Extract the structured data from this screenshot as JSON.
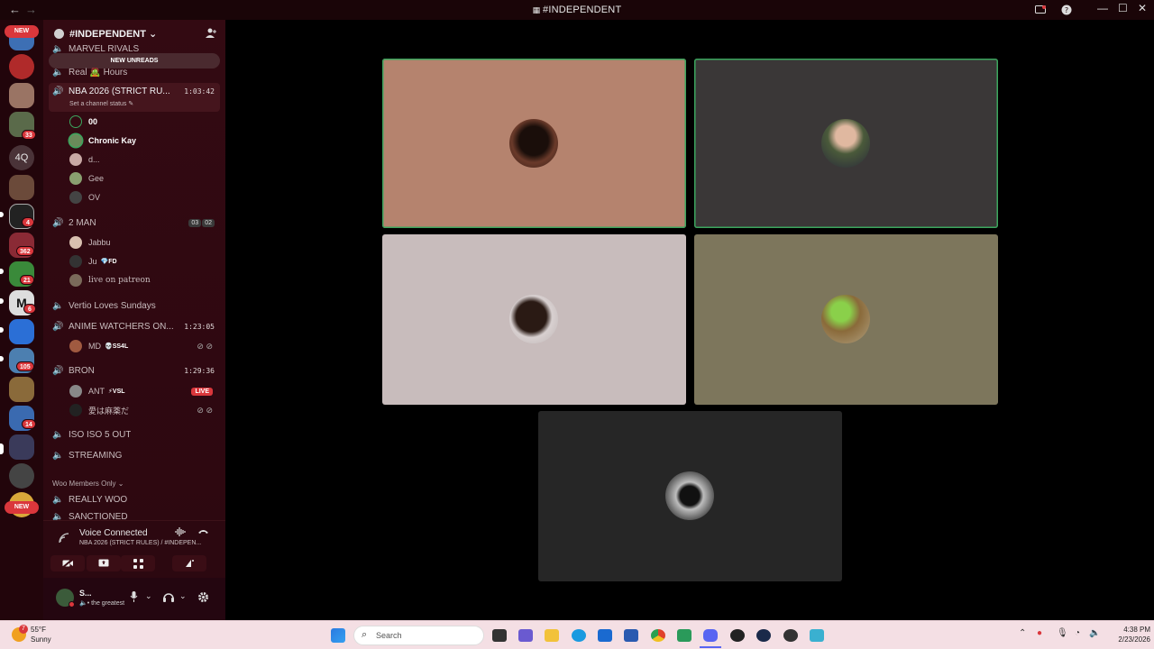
{
  "window": {
    "title": "#INDEPENDENT",
    "back": "←",
    "forward": "→"
  },
  "rail": {
    "new_top": "NEW",
    "new_bottom": "NEW",
    "text_server": "4Q",
    "badges": [
      "33",
      "4",
      "362",
      "21",
      "6",
      "105",
      "14"
    ]
  },
  "server": {
    "name": "#INDEPENDENT",
    "chevron": "⌄",
    "new_unreads": "NEW UNREADS"
  },
  "channels": {
    "marvel": "MARVEL RIVALS",
    "real_hours": "Real 🧟 Hours",
    "nba": {
      "name": "NBA 2026 (STRICT RU...",
      "time": "1:03:42",
      "status_hint": "Set a channel status ✎"
    },
    "nba_users": [
      {
        "name": "00"
      },
      {
        "name": "Chronic Kay"
      },
      {
        "name": "d..."
      },
      {
        "name": "Gee"
      },
      {
        "name": "OV"
      }
    ],
    "two_man": {
      "name": "2 MAN",
      "count_a": "03",
      "count_b": "02"
    },
    "two_man_users": [
      {
        "name": "Jabbu"
      },
      {
        "name": "Ju",
        "tag": "💎FD"
      },
      {
        "name": "live on patreon"
      }
    ],
    "vertio": "Vertio Loves Sundays",
    "anime": {
      "name": "ANIME WATCHERS ON...",
      "time": "1:23:05"
    },
    "anime_users": [
      {
        "name": "MD",
        "tag": "💀SS4L"
      }
    ],
    "bron": {
      "name": "BRON",
      "time": "1:29:36"
    },
    "bron_users": [
      {
        "name": "ANT",
        "tag": "⚡VSL",
        "live": "LIVE"
      },
      {
        "name": "愛は麻薬だ"
      }
    ],
    "iso": "ISO ISO 5 OUT",
    "streaming": "STREAMING",
    "category": "Woo Members Only ⌄",
    "really_woo": "REALLY WOO",
    "sanctioned": "SANCTIONED"
  },
  "voice": {
    "title": "Voice Connected",
    "subtitle": "NBA 2026 (STRICT RULES) / #INDEPEN..."
  },
  "user": {
    "name": "S...",
    "status": "• the greatest"
  },
  "taskbar": {
    "temp": "55°F",
    "weather": "Sunny",
    "weather_badge": "7",
    "search_placeholder": "Search",
    "time": "4:38 PM",
    "date": "2/23/2026"
  },
  "colors": {
    "speaking": "#3ba55d",
    "badge": "#da373c",
    "sidebar": "#330a12"
  }
}
